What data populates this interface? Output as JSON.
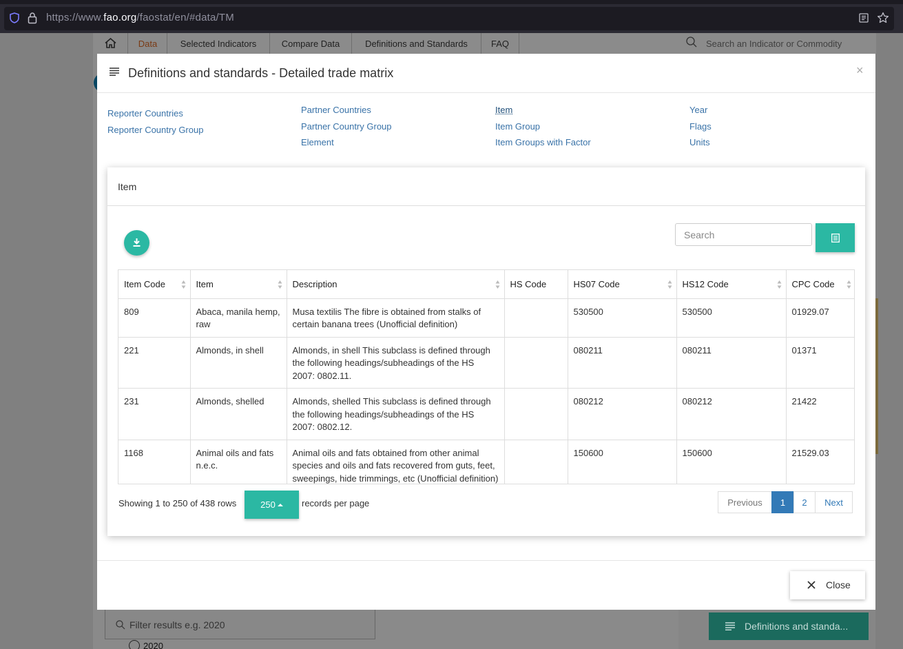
{
  "browser": {
    "url_prefix": "https://www.",
    "url_host": "fao.org",
    "url_path": "/faostat/en/#data/TM"
  },
  "background": {
    "nav": [
      "Data",
      "Selected Indicators",
      "Compare Data",
      "Definitions and Standards",
      "FAQ"
    ],
    "search_placeholder": "Search an Indicator or Commodity",
    "filter_placeholder": "Filter results  e.g. 2020",
    "year_option": "2020",
    "definitions_button": "Definitions and standa..."
  },
  "modal": {
    "title": "Definitions and standards - Detailed trade matrix",
    "links": {
      "col1": [
        "Reporter Countries",
        "Reporter Country Group"
      ],
      "col2": [
        "Partner Countries",
        "Partner Country Group",
        "Element"
      ],
      "col3": [
        "Item",
        "Item Group",
        "Item Groups with Factor"
      ],
      "col4": [
        "Year",
        "Flags",
        "Units"
      ]
    },
    "selected_link": "Item",
    "panel_title": "Item",
    "search_placeholder": "Search",
    "table": {
      "headers": [
        "Item Code",
        "Item",
        "Description",
        "HS Code",
        "HS07 Code",
        "HS12 Code",
        "CPC Code"
      ],
      "rows": [
        [
          "809",
          "Abaca, manila hemp, raw",
          "Musa textilis The fibre is obtained from stalks of certain banana trees (Unofficial definition)",
          "",
          "530500",
          "530500",
          "01929.07"
        ],
        [
          "221",
          "Almonds, in shell",
          "Almonds, in shell This subclass is defined through the following headings/subheadings of the HS 2007: 0802.11.",
          "",
          "080211",
          "080211",
          "01371"
        ],
        [
          "231",
          "Almonds, shelled",
          "Almonds, shelled This subclass is defined through the following headings/subheadings of the HS 2007: 0802.12.",
          "",
          "080212",
          "080212",
          "21422"
        ],
        [
          "1168",
          "Animal oils and fats n.e.c.",
          "Animal oils and fats obtained from other animal species and oils and fats recovered from guts, feet, sweepings, hide trimmings, etc (Unofficial definition)",
          "",
          "150600",
          "150600",
          "21529.03"
        ]
      ]
    },
    "pager": {
      "info": "Showing 1 to 250 of 438 rows",
      "page_size": "250",
      "records_text": "records per page",
      "previous": "Previous",
      "pages": [
        "1",
        "2"
      ],
      "current_page": "1",
      "next": "Next"
    },
    "close_label": "Close"
  },
  "colors": {
    "accent": "#2bb8a3",
    "link": "#3a73a8",
    "active_page": "#337ab7"
  }
}
